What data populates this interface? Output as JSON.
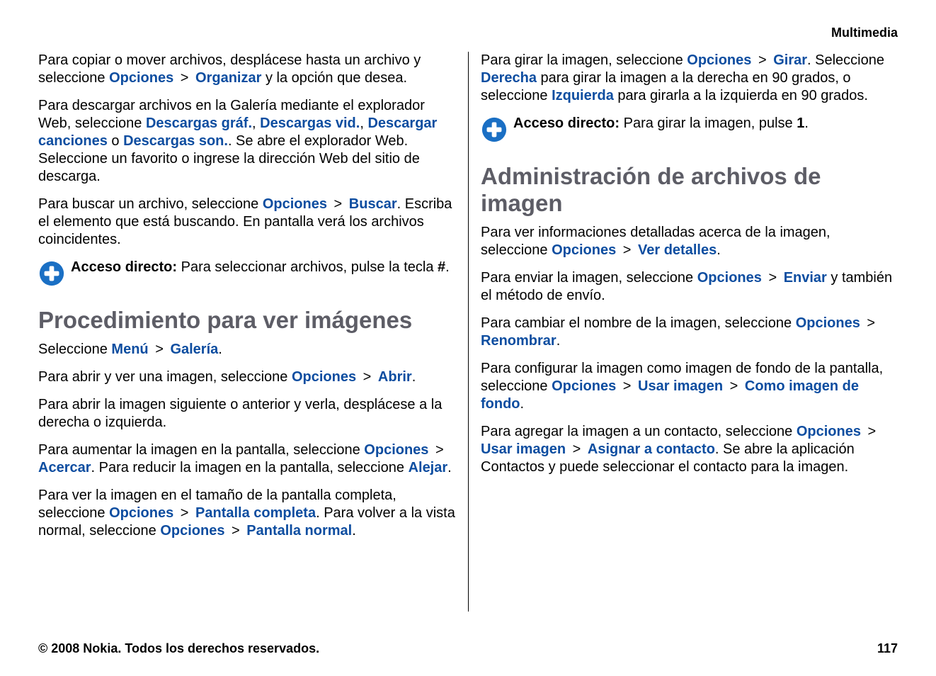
{
  "header": "Multimedia",
  "left": {
    "p1_a": "Para copiar o mover archivos, desplácese hasta un archivo y seleccione ",
    "p1_l1": "Opciones",
    "p1_l2": "Organizar",
    "p1_b": " y la opción que desea.",
    "p2_a": "Para descargar archivos en la Galería mediante el explorador Web, seleccione ",
    "p2_l1": "Descargas gráf.",
    "p2_c1": ", ",
    "p2_l2": "Descargas vid.",
    "p2_c2": ", ",
    "p2_l3": "Descargar canciones",
    "p2_c3": " o ",
    "p2_l4": "Descargas son.",
    "p2_b": ". Se abre el explorador Web. Seleccione un favorito o ingrese la dirección Web del sitio de descarga.",
    "p3_a": "Para buscar un archivo, seleccione ",
    "p3_l1": "Opciones",
    "p3_l2": "Buscar",
    "p3_b": ". Escriba el elemento que está buscando. En pantalla verá los archivos coincidentes.",
    "sc1_label": "Acceso directo:",
    "sc1_a": " Para seleccionar archivos, pulse la tecla ",
    "sc1_key": "#",
    "sc1_b": ".",
    "h1": "Procedimiento para ver imágenes",
    "p4_a": "Seleccione ",
    "p4_l1": "Menú",
    "p4_l2": "Galería",
    "p4_b": ".",
    "p5_a": "Para abrir y ver una imagen, seleccione ",
    "p5_l1": "Opciones",
    "p5_l2": "Abrir",
    "p5_b": ".",
    "p6": "Para abrir la imagen siguiente o anterior y verla, desplácese a la derecha o izquierda.",
    "p7_a": "Para aumentar la imagen en la pantalla, seleccione ",
    "p7_l1": "Opciones",
    "p7_l2": "Acercar",
    "p7_b": ". Para reducir la imagen en la pantalla, seleccione ",
    "p7_l3": "Alejar",
    "p7_c": ".",
    "p8_a": "Para ver la imagen en el tamaño de la pantalla completa, seleccione ",
    "p8_l1": "Opciones",
    "p8_l2": "Pantalla completa",
    "p8_b": ". Para volver a la vista normal, seleccione ",
    "p8_l3": "Opciones",
    "p8_l4": "Pantalla normal",
    "p8_c": "."
  },
  "right": {
    "p1_a": "Para girar la imagen, seleccione ",
    "p1_l1": "Opciones",
    "p1_l2": "Girar",
    "p1_b": ". Seleccione ",
    "p1_l3": "Derecha",
    "p1_c": " para girar la imagen a la derecha en 90 grados, o seleccione ",
    "p1_l4": "Izquierda",
    "p1_d": " para girarla a la izquierda en 90 grados.",
    "sc1_label": "Acceso directo:",
    "sc1_a": " Para girar la imagen, pulse ",
    "sc1_key": "1",
    "sc1_b": ".",
    "h1": "Administración de archivos de imagen",
    "p2_a": "Para ver informaciones detalladas acerca de la imagen, seleccione ",
    "p2_l1": "Opciones",
    "p2_l2": "Ver detalles",
    "p2_b": ".",
    "p3_a": "Para enviar la imagen, seleccione ",
    "p3_l1": "Opciones",
    "p3_l2": "Enviar",
    "p3_b": " y también el método de envío.",
    "p4_a": "Para cambiar el nombre de la imagen, seleccione ",
    "p4_l1": "Opciones",
    "p4_l2": "Renombrar",
    "p4_b": ".",
    "p5_a": "Para configurar la imagen como imagen de fondo de la pantalla, seleccione ",
    "p5_l1": "Opciones",
    "p5_l2": "Usar imagen",
    "p5_l3": "Como imagen de fondo",
    "p5_b": ".",
    "p6_a": "Para agregar la imagen a un contacto, seleccione ",
    "p6_l1": "Opciones",
    "p6_l2": "Usar imagen",
    "p6_l3": "Asignar a contacto",
    "p6_b": ". Se abre la aplicación Contactos y puede seleccionar el contacto para la imagen."
  },
  "footer": {
    "copyright": "© 2008 Nokia. Todos los derechos reservados.",
    "page": "117"
  },
  "gt": ">"
}
